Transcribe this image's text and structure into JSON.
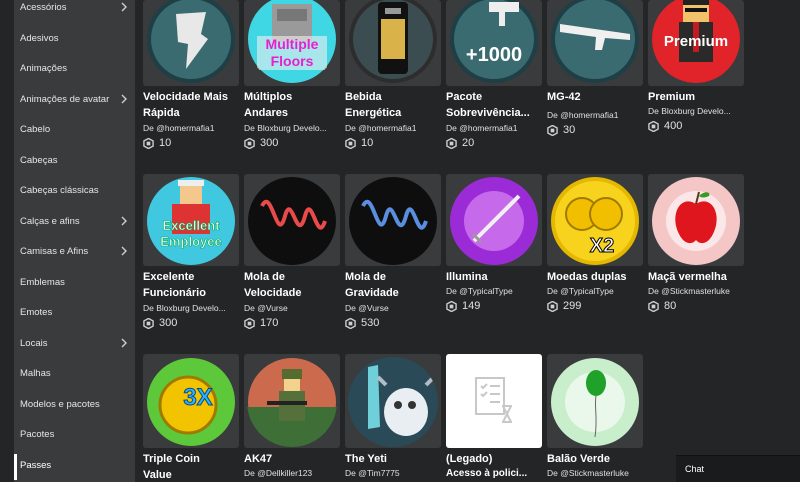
{
  "sidebar": {
    "items": [
      {
        "label": "Acessórios",
        "chevron": true
      },
      {
        "label": "Adesivos",
        "chevron": false
      },
      {
        "label": "Animações",
        "chevron": false
      },
      {
        "label": "Animações de avatar",
        "chevron": true
      },
      {
        "label": "Cabelo",
        "chevron": false
      },
      {
        "label": "Cabeças",
        "chevron": false
      },
      {
        "label": "Cabeças clássicas",
        "chevron": false
      },
      {
        "label": "Calças e afins",
        "chevron": true
      },
      {
        "label": "Camisas e Afins",
        "chevron": true
      },
      {
        "label": "Emblemas",
        "chevron": false
      },
      {
        "label": "Emotes",
        "chevron": false
      },
      {
        "label": "Locais",
        "chevron": true
      },
      {
        "label": "Malhas",
        "chevron": false
      },
      {
        "label": "Modelos e pacotes",
        "chevron": false
      },
      {
        "label": "Pacotes",
        "chevron": false
      },
      {
        "label": "Passes",
        "chevron": false,
        "active": true
      }
    ]
  },
  "items": [
    {
      "title1": "Velocidade Mais",
      "title2": "Rápida",
      "creator": "De @homermafia1",
      "price": "10",
      "icon": "speed-coil-icon"
    },
    {
      "title1": "Múltiplos",
      "title2": "Andares",
      "creator": "De Bloxburg Develo...",
      "price": "300",
      "icon": "multiple-floors-icon",
      "badge_text1": "Multiple",
      "badge_text2": "Floors"
    },
    {
      "title1": "Bebida",
      "title2": "Energética",
      "creator": "De @homermafia1",
      "price": "10",
      "icon": "energy-drink-icon"
    },
    {
      "title1": "Pacote",
      "title2": "Sobrevivência...",
      "creator": "De @homermafia1",
      "price": "20",
      "icon": "survival-pack-icon",
      "badge_text1": "+1000"
    },
    {
      "title1": "MG-42",
      "title2": "",
      "creator": "De @homermafia1",
      "price": "30",
      "icon": "machine-gun-icon"
    },
    {
      "title1": "Premium",
      "title2": "",
      "creator": "De Bloxburg Develo...",
      "price": "400",
      "icon": "premium-avatar-icon",
      "badge_text1": "Premium"
    },
    {
      "title1": "Excelente",
      "title2": "Funcionário",
      "creator": "De Bloxburg Develo...",
      "price": "300",
      "icon": "excellent-employee-icon",
      "badge_text1": "Excellent",
      "badge_text2": "Employee"
    },
    {
      "title1": "Mola de",
      "title2": "Velocidade",
      "creator": "De @Vurse",
      "price": "170",
      "icon": "red-spring-icon"
    },
    {
      "title1": "Mola de",
      "title2": "Gravidade",
      "creator": "De @Vurse",
      "price": "530",
      "icon": "blue-spring-icon"
    },
    {
      "title1": "Illumina",
      "title2": "",
      "creator": "De @TypicalType",
      "price": "149",
      "icon": "sword-icon"
    },
    {
      "title1": "Moedas duplas",
      "title2": "",
      "creator": "De @TypicalType",
      "price": "299",
      "icon": "double-coins-icon",
      "badge_text1": "X2"
    },
    {
      "title1": "Maçã vermelha",
      "title2": "",
      "creator": "De @Stickmasterluke",
      "price": "80",
      "icon": "red-apple-icon"
    },
    {
      "title1": "Triple Coin",
      "title2": "Value",
      "creator": "",
      "price": "",
      "icon": "triple-coin-icon",
      "badge_text1": "3X"
    },
    {
      "title1": "AK47",
      "title2": "",
      "creator": "De @Dellkiller123",
      "price": "",
      "icon": "soldier-avatar-icon"
    },
    {
      "title1": "The Yeti",
      "title2": "",
      "creator": "De @Tim7775",
      "price": "",
      "icon": "yeti-icon"
    },
    {
      "title1": "(Legado)",
      "title2": "",
      "creator": "Acesso à polici...",
      "price": "",
      "icon": "placeholder-document-icon"
    },
    {
      "title1": "Balão Verde",
      "title2": "",
      "creator": "De @Stickmasterluke",
      "price": "",
      "icon": "green-balloon-icon"
    }
  ],
  "chat": {
    "label": "Chat"
  },
  "colors": {
    "background": "#232527",
    "sidebar": "#393b3d",
    "card": "#393b3d"
  }
}
